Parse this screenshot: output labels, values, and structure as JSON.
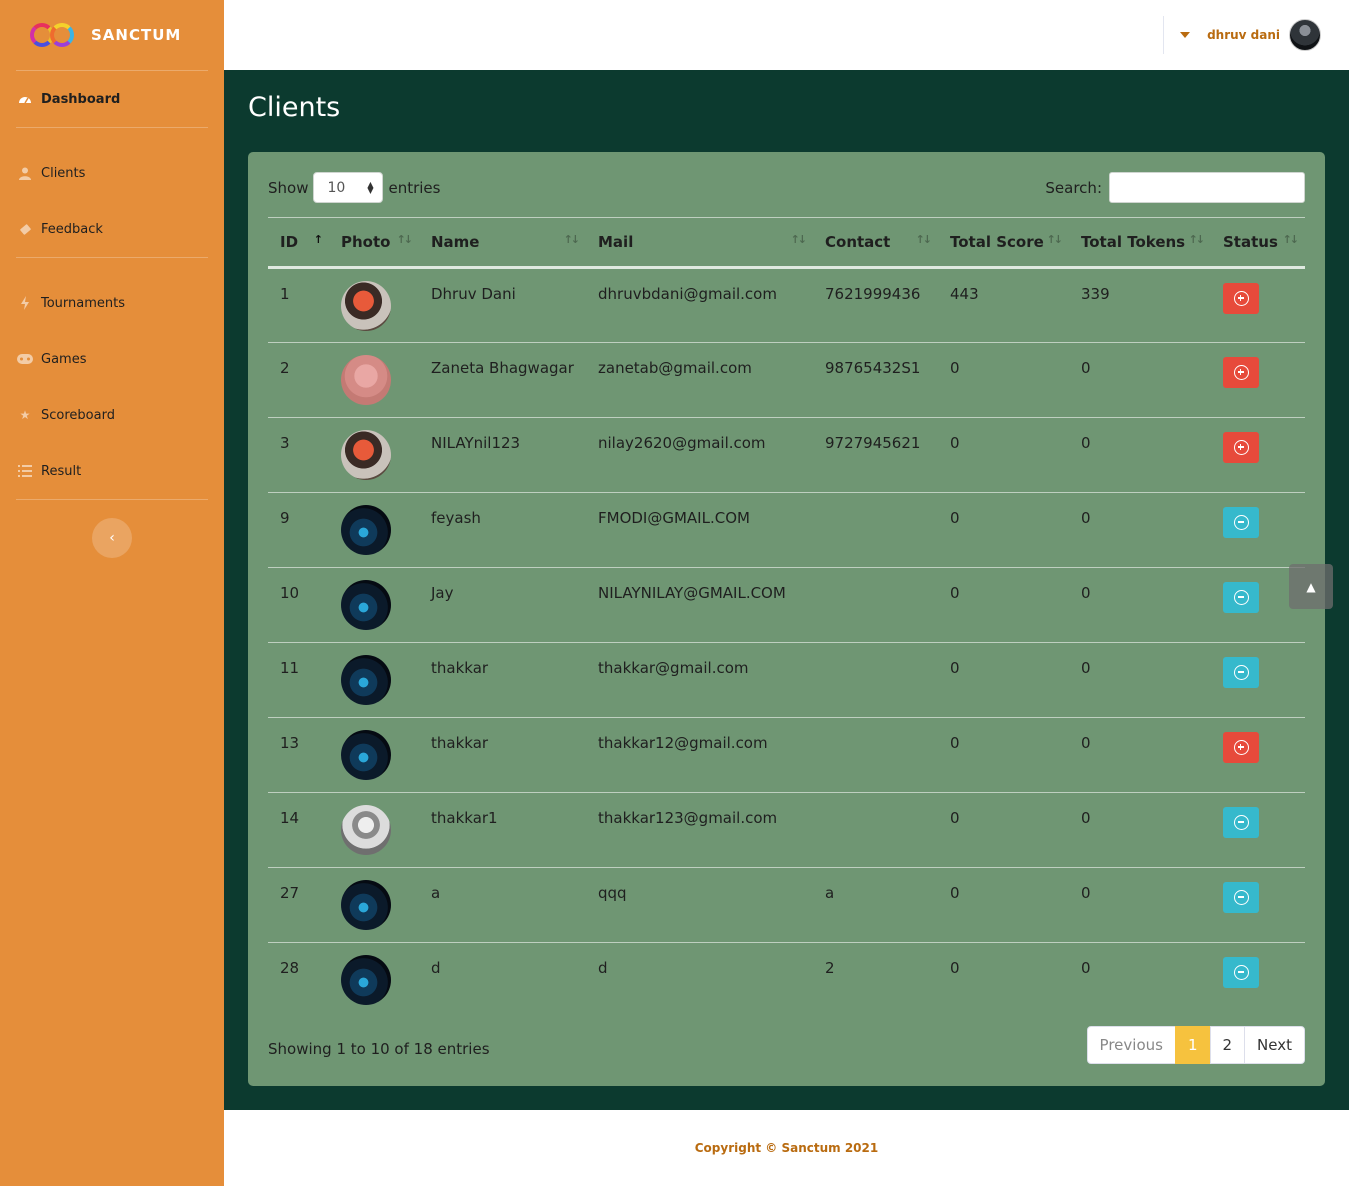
{
  "brand": {
    "name": "SANCTUM"
  },
  "sidebar": {
    "items": [
      {
        "label": "Dashboard",
        "icon": "tachometer-icon"
      },
      {
        "label": "Clients",
        "icon": "user-icon"
      },
      {
        "label": "Feedback",
        "icon": "ticket-icon"
      },
      {
        "label": "Tournaments",
        "icon": "bolt-icon"
      },
      {
        "label": "Games",
        "icon": "gamepad-icon"
      },
      {
        "label": "Scoreboard",
        "icon": "star-icon"
      },
      {
        "label": "Result",
        "icon": "list-icon"
      }
    ],
    "toggle_icon": "chevron-left-icon"
  },
  "topbar": {
    "user_name": "dhruv dani"
  },
  "page": {
    "title": "Clients"
  },
  "table_controls": {
    "show_label": "Show",
    "entries_label": "entries",
    "page_size": "10",
    "search_label": "Search:",
    "search_value": ""
  },
  "table": {
    "columns": [
      "ID",
      "Photo",
      "Name",
      "Mail",
      "Contact",
      "Total Score",
      "Total Tokens",
      "Status"
    ],
    "rows": [
      {
        "id": "1",
        "name": "Dhruv Dani",
        "mail": "dhruvbdani@gmail.com",
        "contact": "7621999436",
        "score": "443",
        "tokens": "339",
        "status": "add",
        "photo": "orange"
      },
      {
        "id": "2",
        "name": "Zaneta Bhagwagar",
        "mail": "zanetab@gmail.com",
        "contact": "98765432S1",
        "score": "0",
        "tokens": "0",
        "status": "add",
        "photo": "pink"
      },
      {
        "id": "3",
        "name": "NILAYnil123",
        "mail": "nilay2620@gmail.com",
        "contact": "9727945621",
        "score": "0",
        "tokens": "0",
        "status": "add",
        "photo": "orange"
      },
      {
        "id": "9",
        "name": "feyash",
        "mail": "FMODI@GMAIL.COM",
        "contact": "",
        "score": "0",
        "tokens": "0",
        "status": "remove",
        "photo": "dark"
      },
      {
        "id": "10",
        "name": "Jay",
        "mail": "NILAYNILAY@GMAIL.COM",
        "contact": "",
        "score": "0",
        "tokens": "0",
        "status": "remove",
        "photo": "dark"
      },
      {
        "id": "11",
        "name": "thakkar",
        "mail": "thakkar@gmail.com",
        "contact": "",
        "score": "0",
        "tokens": "0",
        "status": "remove",
        "photo": "dark"
      },
      {
        "id": "13",
        "name": "thakkar",
        "mail": "thakkar12@gmail.com",
        "contact": "",
        "score": "0",
        "tokens": "0",
        "status": "add",
        "photo": "dark"
      },
      {
        "id": "14",
        "name": "thakkar1",
        "mail": "thakkar123@gmail.com",
        "contact": "",
        "score": "0",
        "tokens": "0",
        "status": "remove",
        "photo": "bw"
      },
      {
        "id": "27",
        "name": "a",
        "mail": "qqq",
        "contact": "a",
        "score": "0",
        "tokens": "0",
        "status": "remove",
        "photo": "dark"
      },
      {
        "id": "28",
        "name": "d",
        "mail": "d",
        "contact": "2",
        "score": "0",
        "tokens": "0",
        "status": "remove",
        "photo": "dark"
      }
    ]
  },
  "footer_info": {
    "showing_text": "Showing 1 to 10 of 18 entries"
  },
  "pagination": {
    "previous": "Previous",
    "pages": [
      "1",
      "2"
    ],
    "current": "1",
    "next": "Next"
  },
  "footer": {
    "copyright": "Copyright © Sanctum 2021"
  },
  "colors": {
    "sidebar": "#e58e3a",
    "content_bg": "#0c3a2f",
    "card": "#6f9673",
    "danger": "#e74a3b",
    "info": "#36b9cc",
    "accent_text": "#b96b10"
  }
}
